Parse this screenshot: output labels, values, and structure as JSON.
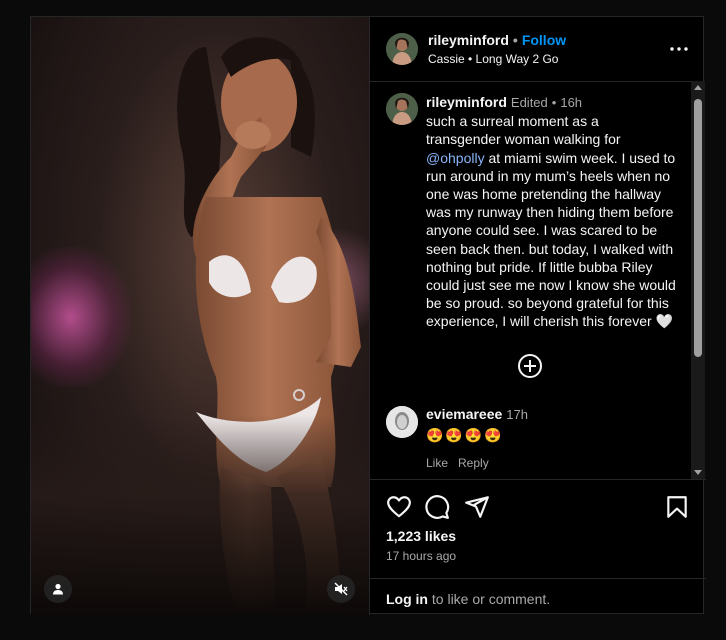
{
  "post": {
    "username": "rileyminford",
    "follow_label": "Follow",
    "separator": "•",
    "audio": "Cassie • Long Way 2 Go",
    "more_icon": "more-options-icon"
  },
  "caption": {
    "username": "rileyminford",
    "edited": "Edited",
    "dot": "•",
    "time": "16h",
    "text_before_mention": "such a surreal moment as a transgender woman walking for ",
    "mention": "@ohpolly",
    "text_after_mention": " at miami swim week. I used to run around in my mum’s heels when no one was home pretending the hallway was my runway then hiding them before anyone could see. I was scared to be seen back then. but today, I walked with nothing but pride. If little bubba Riley could just see me now I know she would be so proud. so beyond grateful for this experience, I will cherish this forever 🤍"
  },
  "comments": [
    {
      "username": "eviemareee",
      "time": "17h",
      "text": "😍😍😍😍",
      "like_label": "Like",
      "reply_label": "Reply"
    }
  ],
  "actions": {
    "likes": "1,223 likes",
    "time_ago": "17 hours ago",
    "login_link": "Log in",
    "login_suffix": " to like or comment."
  },
  "colors": {
    "accent": "#0095f6",
    "background": "#000000",
    "text": "#f5f5f5",
    "muted": "#a8a8a8"
  }
}
